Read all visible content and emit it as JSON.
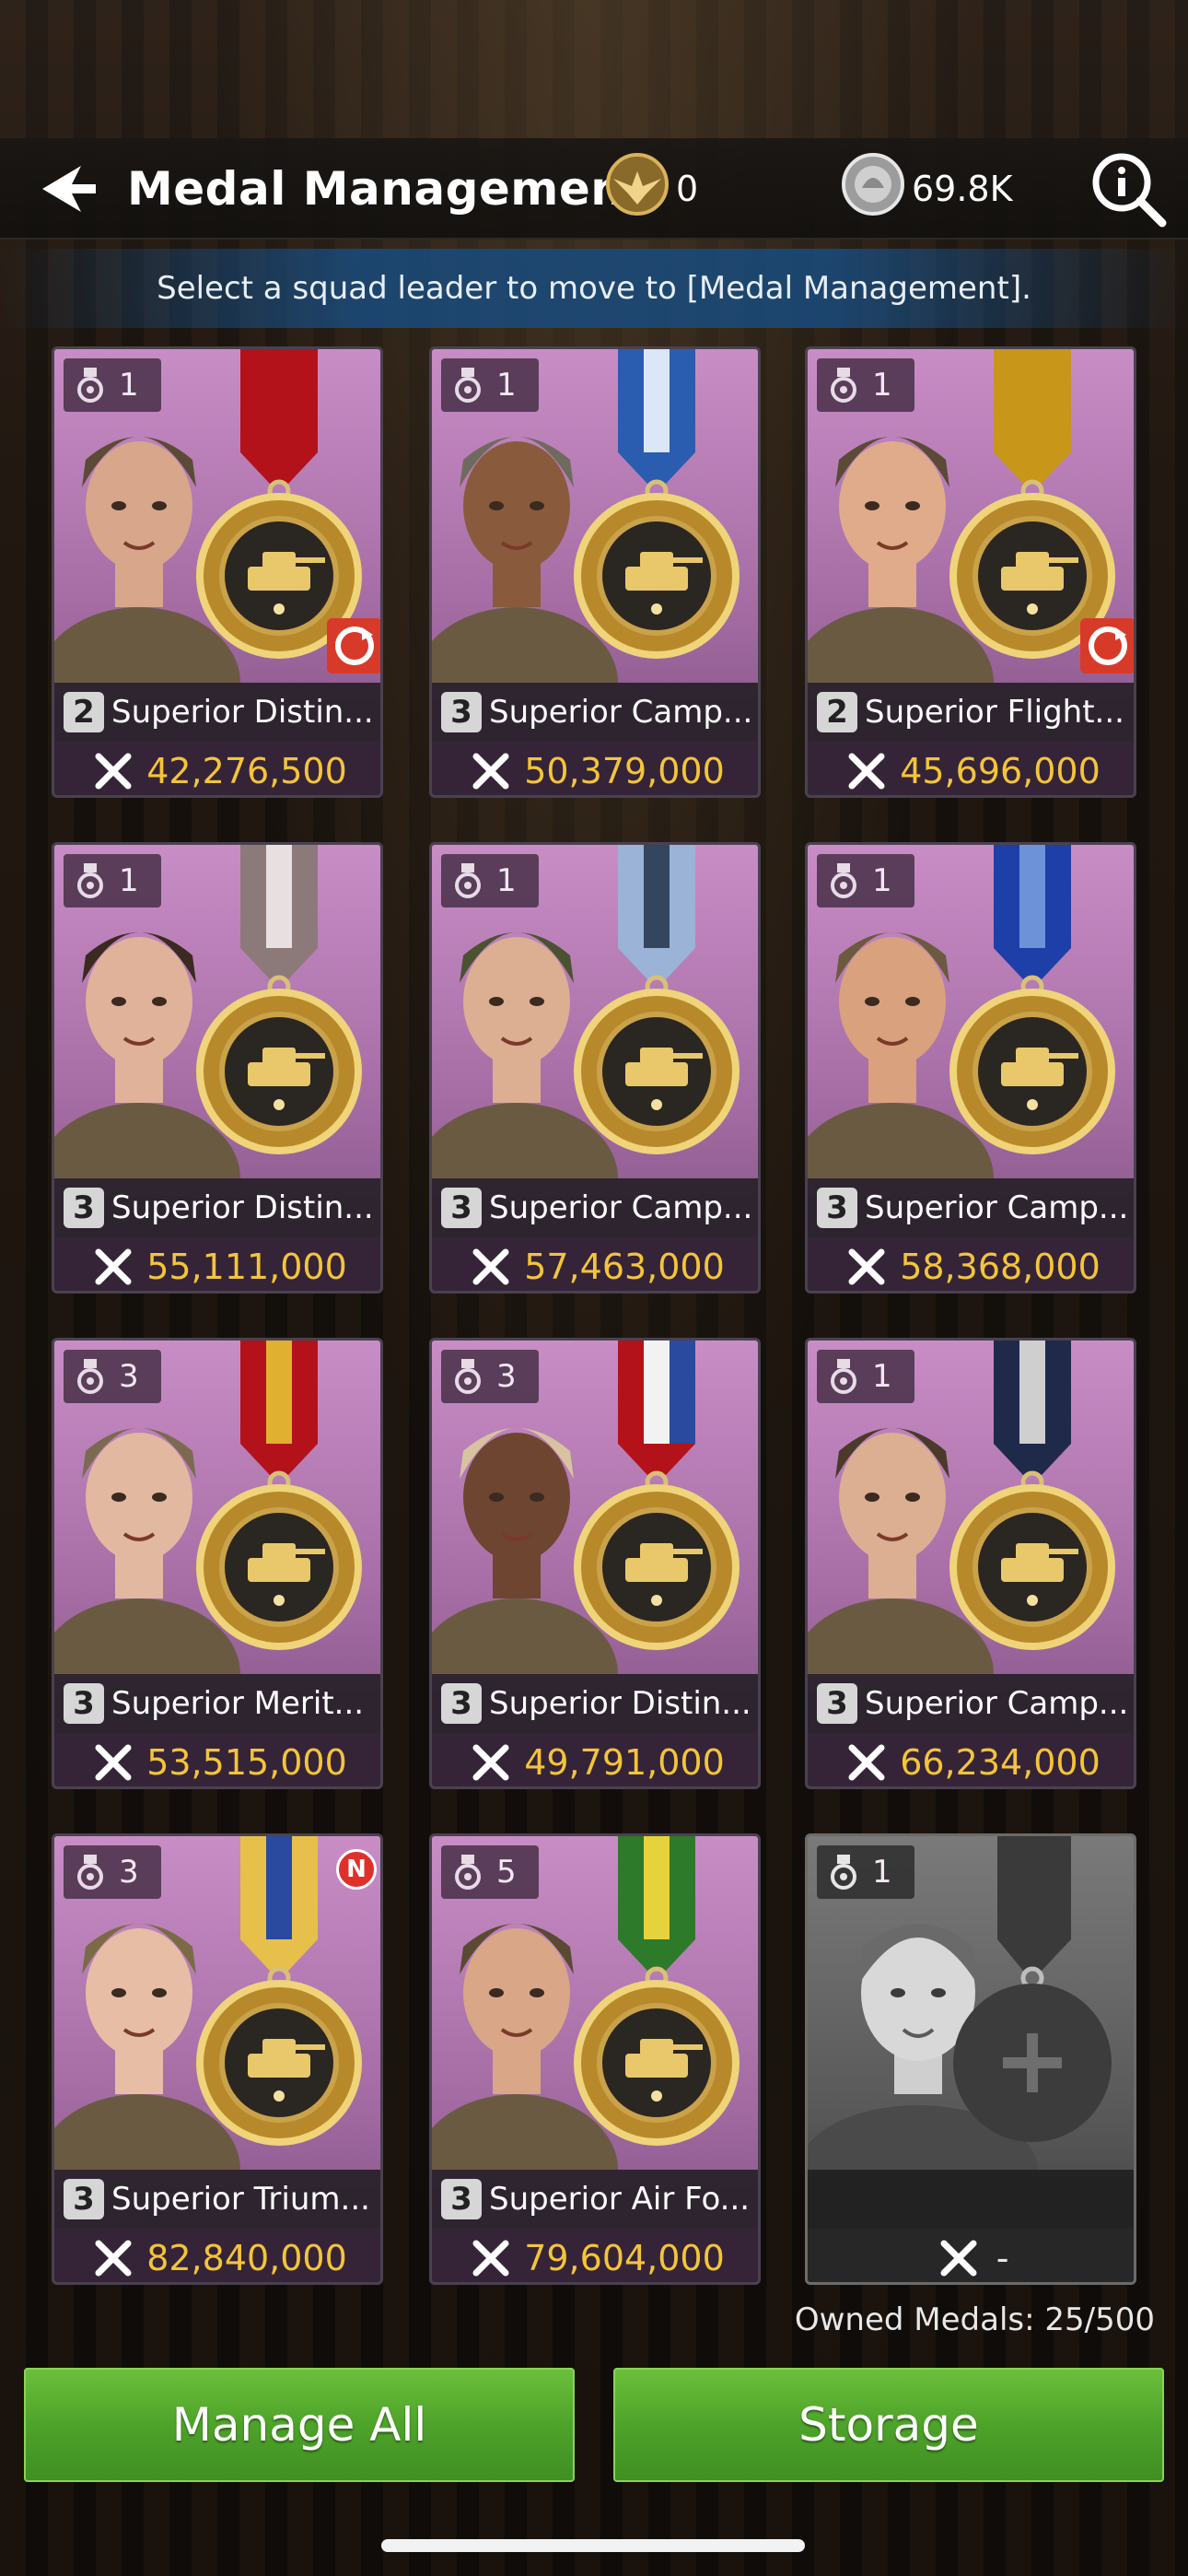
{
  "header": {
    "title": "Medal Management",
    "eagle_count": "0",
    "silver_count": "69.8K"
  },
  "hint": "Select a squad leader to move to [Medal Management].",
  "cards": [
    {
      "level": "1",
      "tier": "2",
      "name": "Superior Distin...",
      "power": "42,276,500",
      "ribbon": [
        "#b3121a",
        "#b3121a",
        "#b3121a"
      ],
      "hero_skin": "#d7a68b",
      "hero_hat": "#5b4a35",
      "corner_icon": true
    },
    {
      "level": "1",
      "tier": "3",
      "name": "Superior Camp...",
      "power": "50,379,000",
      "ribbon": [
        "#2a5db0",
        "#dbe6f6",
        "#2a5db0"
      ],
      "hero_skin": "#8a5a3c",
      "hero_hat": "#6f6a5e",
      "corner_icon": false
    },
    {
      "level": "1",
      "tier": "2",
      "name": "Superior Flight...",
      "power": "45,696,000",
      "ribbon": [
        "#c89618",
        "#c89618",
        "#c89618"
      ],
      "hero_skin": "#e0ab8a",
      "hero_hat": "#5a4a36",
      "corner_icon": true
    },
    {
      "level": "1",
      "tier": "3",
      "name": "Superior Distin...",
      "power": "55,111,000",
      "ribbon": [
        "#8c7a7a",
        "#e8e0e0",
        "#8c7a7a"
      ],
      "hero_skin": "#e0b299",
      "hero_hat": "#3a2a20",
      "corner_icon": false
    },
    {
      "level": "1",
      "tier": "3",
      "name": "Superior Camp...",
      "power": "57,463,000",
      "ribbon": [
        "#9ab3d6",
        "#34455e",
        "#9ab3d6"
      ],
      "hero_skin": "#dcae92",
      "hero_hat": "#4b5232",
      "corner_icon": false
    },
    {
      "level": "1",
      "tier": "3",
      "name": "Superior Camp...",
      "power": "58,368,000",
      "ribbon": [
        "#1f3fa8",
        "#6d92d8",
        "#1f3fa8"
      ],
      "hero_skin": "#d9a17d",
      "hero_hat": "#6b5a3e",
      "corner_icon": false
    },
    {
      "level": "3",
      "tier": "3",
      "name": "Superior Merit...",
      "power": "53,515,000",
      "ribbon": [
        "#b3121a",
        "#e0b030",
        "#b3121a"
      ],
      "hero_skin": "#e3b8a0",
      "hero_hat": "#7b6a50",
      "corner_icon": false
    },
    {
      "level": "3",
      "tier": "3",
      "name": "Superior Distin...",
      "power": "49,791,000",
      "ribbon": [
        "#b3121a",
        "#f2f2f2",
        "#2a4aa0"
      ],
      "hero_skin": "#6e4530",
      "hero_hat": "#d8c3a0",
      "corner_icon": false
    },
    {
      "level": "1",
      "tier": "3",
      "name": "Superior Camp...",
      "power": "66,234,000",
      "ribbon": [
        "#1f2a4a",
        "#cfcfcf",
        "#1f2a4a"
      ],
      "hero_skin": "#dcae92",
      "hero_hat": "#4a3a2a",
      "corner_icon": false
    },
    {
      "level": "3",
      "tier": "3",
      "name": "Superior Trium...",
      "power": "82,840,000",
      "ribbon": [
        "#e6c04a",
        "#2a4aa0",
        "#e6c04a"
      ],
      "hero_skin": "#e8bda6",
      "hero_hat": "#7a6a45",
      "corner_icon": false,
      "alert": "N"
    },
    {
      "level": "5",
      "tier": "3",
      "name": "Superior Air Fo...",
      "power": "79,604,000",
      "ribbon": [
        "#2d7a2a",
        "#e6d23a",
        "#2d7a2a"
      ],
      "hero_skin": "#d9a688",
      "hero_hat": "#5a4a32",
      "corner_icon": false
    }
  ],
  "empty_card": {
    "level": "1",
    "power": "-"
  },
  "owned_medals": "Owned Medals: 25/500",
  "buttons": {
    "manage_all": "Manage All",
    "storage": "Storage"
  }
}
